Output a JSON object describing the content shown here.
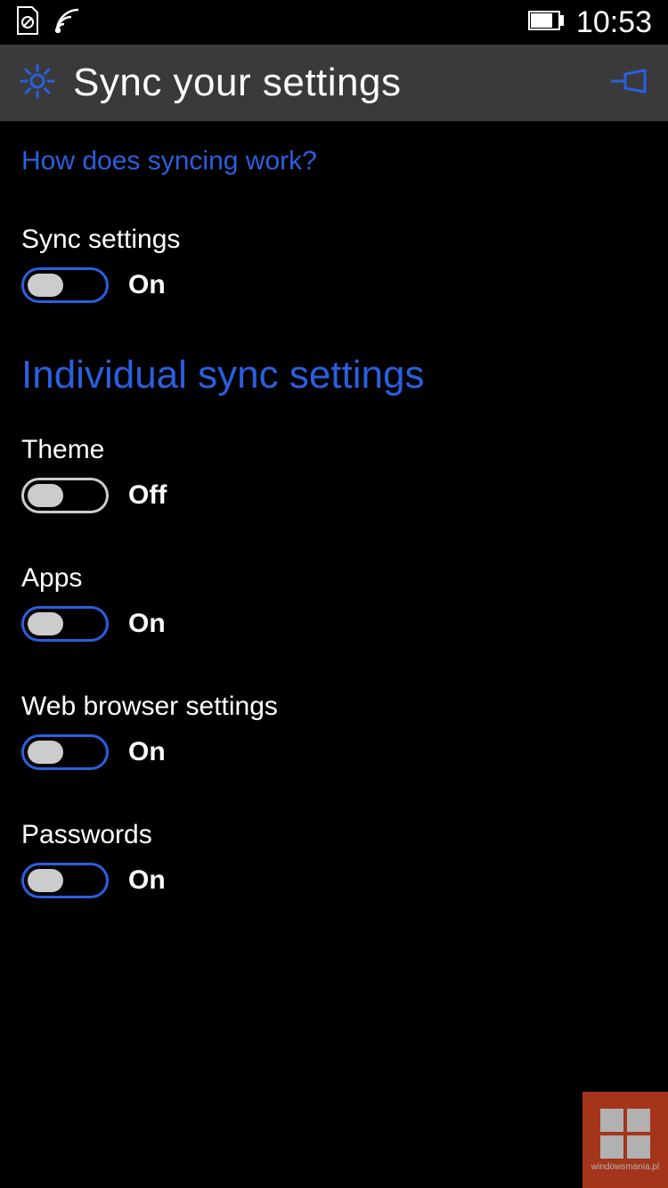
{
  "status": {
    "time": "10:53"
  },
  "header": {
    "title": "Sync your settings"
  },
  "content": {
    "help_link": "How does syncing work?",
    "sync_settings": {
      "label": "Sync settings",
      "state_text": "On",
      "on": true
    },
    "section_heading": "Individual sync settings",
    "items": [
      {
        "label": "Theme",
        "state_text": "Off",
        "on": false
      },
      {
        "label": "Apps",
        "state_text": "On",
        "on": true
      },
      {
        "label": "Web browser settings",
        "state_text": "On",
        "on": true
      },
      {
        "label": "Passwords",
        "state_text": "On",
        "on": true
      }
    ]
  },
  "watermark": {
    "text": "windowsmania.pl"
  },
  "colors": {
    "accent": "#2a5fe0",
    "background": "#000000",
    "header_bg": "#3a3a3a"
  }
}
